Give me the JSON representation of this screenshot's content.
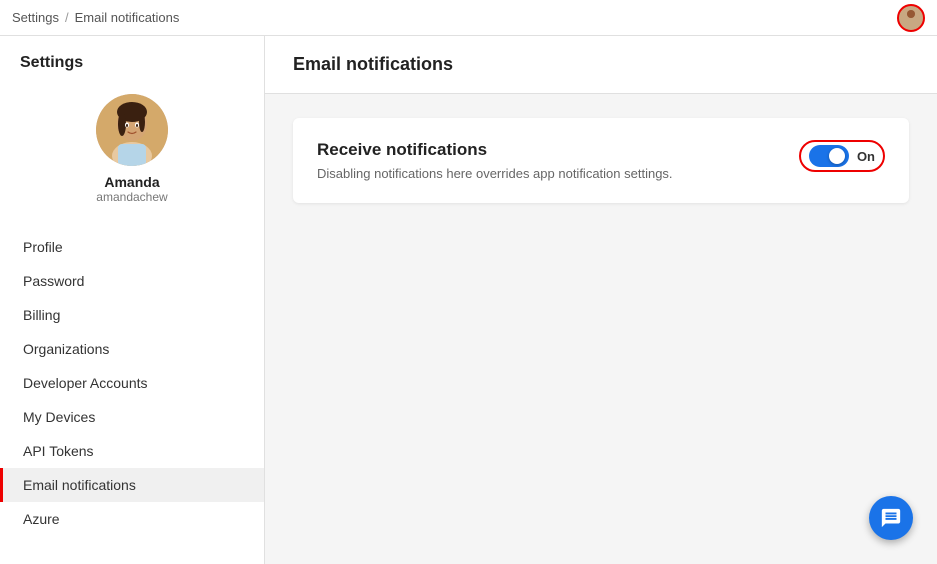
{
  "topbar": {
    "breadcrumb_root": "Settings",
    "breadcrumb_sep": "/",
    "breadcrumb_current": "Email notifications"
  },
  "sidebar": {
    "title": "Settings",
    "user": {
      "name": "Amanda",
      "handle": "amandachew"
    },
    "nav_items": [
      {
        "id": "profile",
        "label": "Profile",
        "active": false
      },
      {
        "id": "password",
        "label": "Password",
        "active": false
      },
      {
        "id": "billing",
        "label": "Billing",
        "active": false
      },
      {
        "id": "organizations",
        "label": "Organizations",
        "active": false
      },
      {
        "id": "developer-accounts",
        "label": "Developer Accounts",
        "active": false
      },
      {
        "id": "my-devices",
        "label": "My Devices",
        "active": false
      },
      {
        "id": "api-tokens",
        "label": "API Tokens",
        "active": false
      },
      {
        "id": "email-notifications",
        "label": "Email notifications",
        "active": true
      },
      {
        "id": "azure",
        "label": "Azure",
        "active": false
      }
    ]
  },
  "main": {
    "header_title": "Email notifications",
    "card": {
      "title": "Receive notifications",
      "description": "Disabling notifications here overrides app notification settings.",
      "toggle_state": "On",
      "toggle_on": true
    }
  }
}
